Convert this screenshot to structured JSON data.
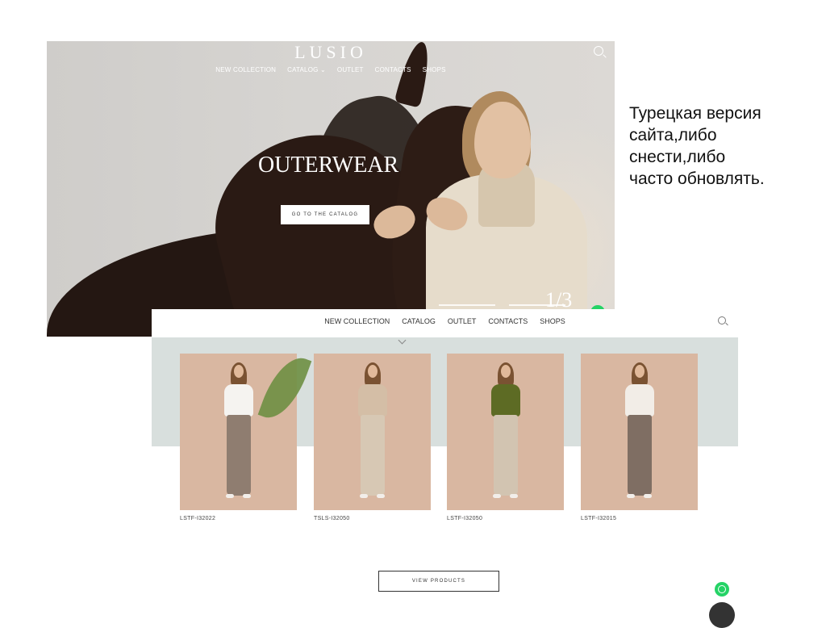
{
  "hero": {
    "brand": "LUSIO",
    "nav": [
      "NEW COLLECTION",
      "CATALOG ⌄",
      "OUTLET",
      "CONTACTS",
      "SHOPS"
    ],
    "headline": "OUTERWEAR",
    "cta_label": "GO TO THE CATALOG",
    "page_indicator": "1/3"
  },
  "note": {
    "text": "Турецкая версия\nсайта,либо\nснести,либо\nчасто обновлять."
  },
  "catalog": {
    "nav": [
      "NEW COLLECTION",
      "CATALOG",
      "OUTLET",
      "CONTACTS",
      "SHOPS"
    ],
    "products": [
      {
        "sku": "LSTF-I32022",
        "top_color": "#f5f3f0",
        "legs_color": "#8f7d70"
      },
      {
        "sku": "TSLS-I32050",
        "top_color": "#d4bea6",
        "legs_color": "#d7c8b4"
      },
      {
        "sku": "LSTF-I32050",
        "top_color": "#5d6b24",
        "legs_color": "#d2c4b1"
      },
      {
        "sku": "LSTF-I32015",
        "top_color": "#f2ede7",
        "legs_color": "#7f6e63"
      }
    ],
    "view_products_label": "VIEW PRODUCTS"
  }
}
